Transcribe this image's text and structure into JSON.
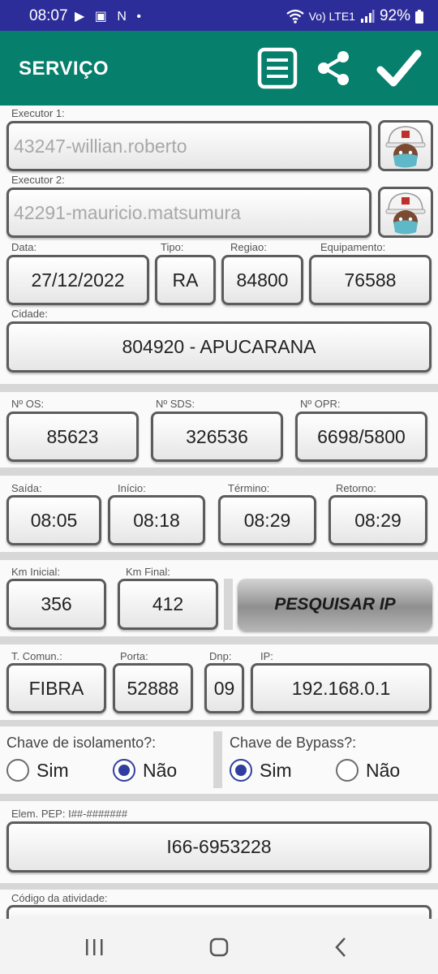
{
  "status_bar": {
    "time": "08:07",
    "left_icons": "▶ ▣ N •",
    "network": "Vo) LTE1",
    "battery": "92%"
  },
  "app_bar": {
    "title": "SERVIÇO"
  },
  "executor1": {
    "label": "Executor 1:",
    "value": "43247-willian.roberto"
  },
  "executor2": {
    "label": "Executor 2:",
    "value": "42291-mauricio.matsumura"
  },
  "data": {
    "label": "Data:",
    "value": "27/12/2022"
  },
  "tipo": {
    "label": "Tipo:",
    "value": "RA"
  },
  "regiao": {
    "label": "Regiao:",
    "value": "84800"
  },
  "equipamento": {
    "label": "Equipamento:",
    "value": "76588"
  },
  "cidade": {
    "label": "Cidade:",
    "value": "804920 - APUCARANA"
  },
  "os": {
    "label": "Nº OS:",
    "value": "85623"
  },
  "sds": {
    "label": "Nº SDS:",
    "value": "326536"
  },
  "opr": {
    "label": "Nº OPR:",
    "value": "6698/5800"
  },
  "saida": {
    "label": "Saída:",
    "value": "08:05"
  },
  "inicio": {
    "label": "Início:",
    "value": "08:18"
  },
  "termino": {
    "label": "Término:",
    "value": "08:29"
  },
  "retorno": {
    "label": "Retorno:",
    "value": "08:29"
  },
  "km_inicial": {
    "label": "Km Inicial:",
    "value": "356"
  },
  "km_final": {
    "label": "Km Final:",
    "value": "412"
  },
  "pesquisar_ip": {
    "label": "PESQUISAR IP"
  },
  "t_comun": {
    "label": "T. Comun.:",
    "value": "FIBRA"
  },
  "porta": {
    "label": "Porta:",
    "value": "52888"
  },
  "dnp": {
    "label": "Dnp:",
    "value": "09"
  },
  "ip": {
    "label": "IP:",
    "value": "192.168.0.1"
  },
  "chave_isolamento": {
    "question": "Chave de isolamento?:",
    "option_yes": "Sim",
    "option_no": "Não",
    "selected": "Não"
  },
  "chave_bypass": {
    "question": "Chave de Bypass?:",
    "option_yes": "Sim",
    "option_no": "Não",
    "selected": "Sim"
  },
  "elem_pep": {
    "label": "Elem. PEP: I##-#######",
    "value": "I66-6953228"
  },
  "codigo_atividade": {
    "label": "Código da atividade:"
  },
  "colors": {
    "app_bar": "#067f6c",
    "status_bar": "#2d2d9a",
    "radio_selected": "#303f9f"
  }
}
